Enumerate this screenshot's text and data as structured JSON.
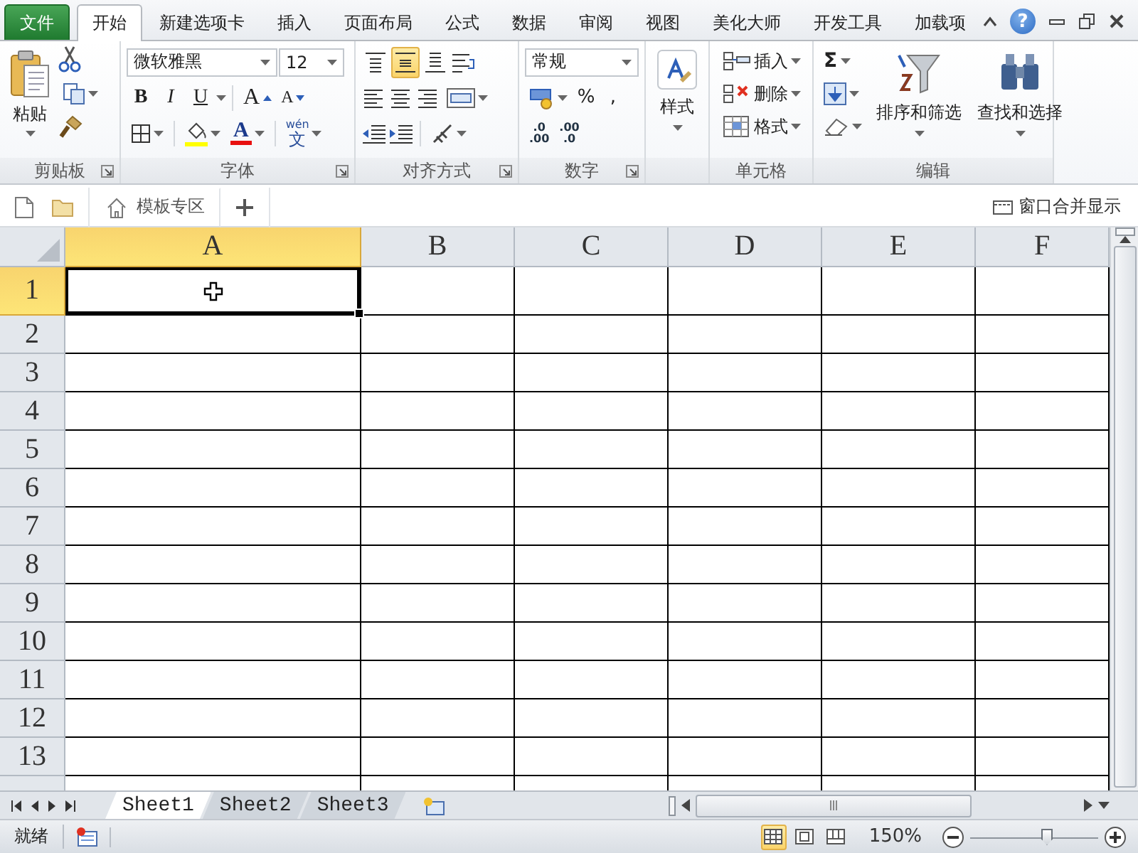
{
  "menu_tabs": [
    {
      "label": "文件",
      "kind": "file",
      "selected": false
    },
    {
      "label": "开始",
      "kind": "tab",
      "selected": true
    },
    {
      "label": "新建选项卡",
      "kind": "tab",
      "selected": false
    },
    {
      "label": "插入",
      "kind": "tab",
      "selected": false
    },
    {
      "label": "页面布局",
      "kind": "tab",
      "selected": false
    },
    {
      "label": "公式",
      "kind": "tab",
      "selected": false
    },
    {
      "label": "数据",
      "kind": "tab",
      "selected": false
    },
    {
      "label": "审阅",
      "kind": "tab",
      "selected": false
    },
    {
      "label": "视图",
      "kind": "tab",
      "selected": false
    },
    {
      "label": "美化大师",
      "kind": "tab",
      "selected": false
    },
    {
      "label": "开发工具",
      "kind": "tab",
      "selected": false
    },
    {
      "label": "加载项",
      "kind": "tab",
      "selected": false
    }
  ],
  "help_label": "?",
  "ribbon": {
    "clipboard": {
      "label": "剪贴板",
      "paste": "粘贴"
    },
    "font": {
      "label": "字体",
      "font_name": "微软雅黑",
      "font_size": "12",
      "style_buttons": [
        "B",
        "I",
        "U"
      ],
      "size_buttons": [
        "A",
        "A"
      ],
      "font_color": "A",
      "phonetic": {
        "top": "wén",
        "bottom": "文"
      }
    },
    "alignment": {
      "label": "对齐方式",
      "vertical": [
        {
          "selected": false
        },
        {
          "selected": true
        },
        {
          "selected": false
        }
      ]
    },
    "number": {
      "label": "数字",
      "format": "常规",
      "symbols": [
        "%",
        ","
      ],
      "decimals": [
        {
          "top": ".0",
          "bottom": ".00"
        },
        {
          "top": ".00",
          "bottom": ".0"
        }
      ]
    },
    "styles": {
      "label": "样式"
    },
    "cells": {
      "label": "单元格",
      "items": [
        "插入",
        "删除",
        "格式"
      ]
    },
    "editing": {
      "label": "编辑",
      "autosum": "Σ",
      "sort": "排序和筛选",
      "find": "查找和选择"
    }
  },
  "doc_bar": {
    "template_tab": "模板专区",
    "merge_windows": "窗口合并显示"
  },
  "sheet": {
    "columns": [
      {
        "label": "A",
        "selected": true
      },
      {
        "label": "B",
        "selected": false
      },
      {
        "label": "C",
        "selected": false
      },
      {
        "label": "D",
        "selected": false
      },
      {
        "label": "E",
        "selected": false
      },
      {
        "label": "F",
        "selected": false
      }
    ],
    "rows": [
      {
        "label": "1",
        "selected": true
      },
      {
        "label": "2",
        "selected": false
      },
      {
        "label": "3",
        "selected": false
      },
      {
        "label": "4",
        "selected": false
      },
      {
        "label": "5",
        "selected": false
      },
      {
        "label": "6",
        "selected": false
      },
      {
        "label": "7",
        "selected": false
      },
      {
        "label": "8",
        "selected": false
      },
      {
        "label": "9",
        "selected": false
      },
      {
        "label": "10",
        "selected": false
      },
      {
        "label": "11",
        "selected": false
      },
      {
        "label": "12",
        "selected": false
      },
      {
        "label": "13",
        "selected": false
      }
    ]
  },
  "sheet_tabs": [
    {
      "label": "Sheet1",
      "selected": true
    },
    {
      "label": "Sheet2",
      "selected": false
    },
    {
      "label": "Sheet3",
      "selected": false
    }
  ],
  "status_bar": {
    "text": "就绪",
    "views": [
      {
        "selected": true
      },
      {
        "selected": false
      },
      {
        "selected": false
      }
    ],
    "zoom": "150%",
    "zoom_slider": {
      "level": 0.6
    }
  }
}
